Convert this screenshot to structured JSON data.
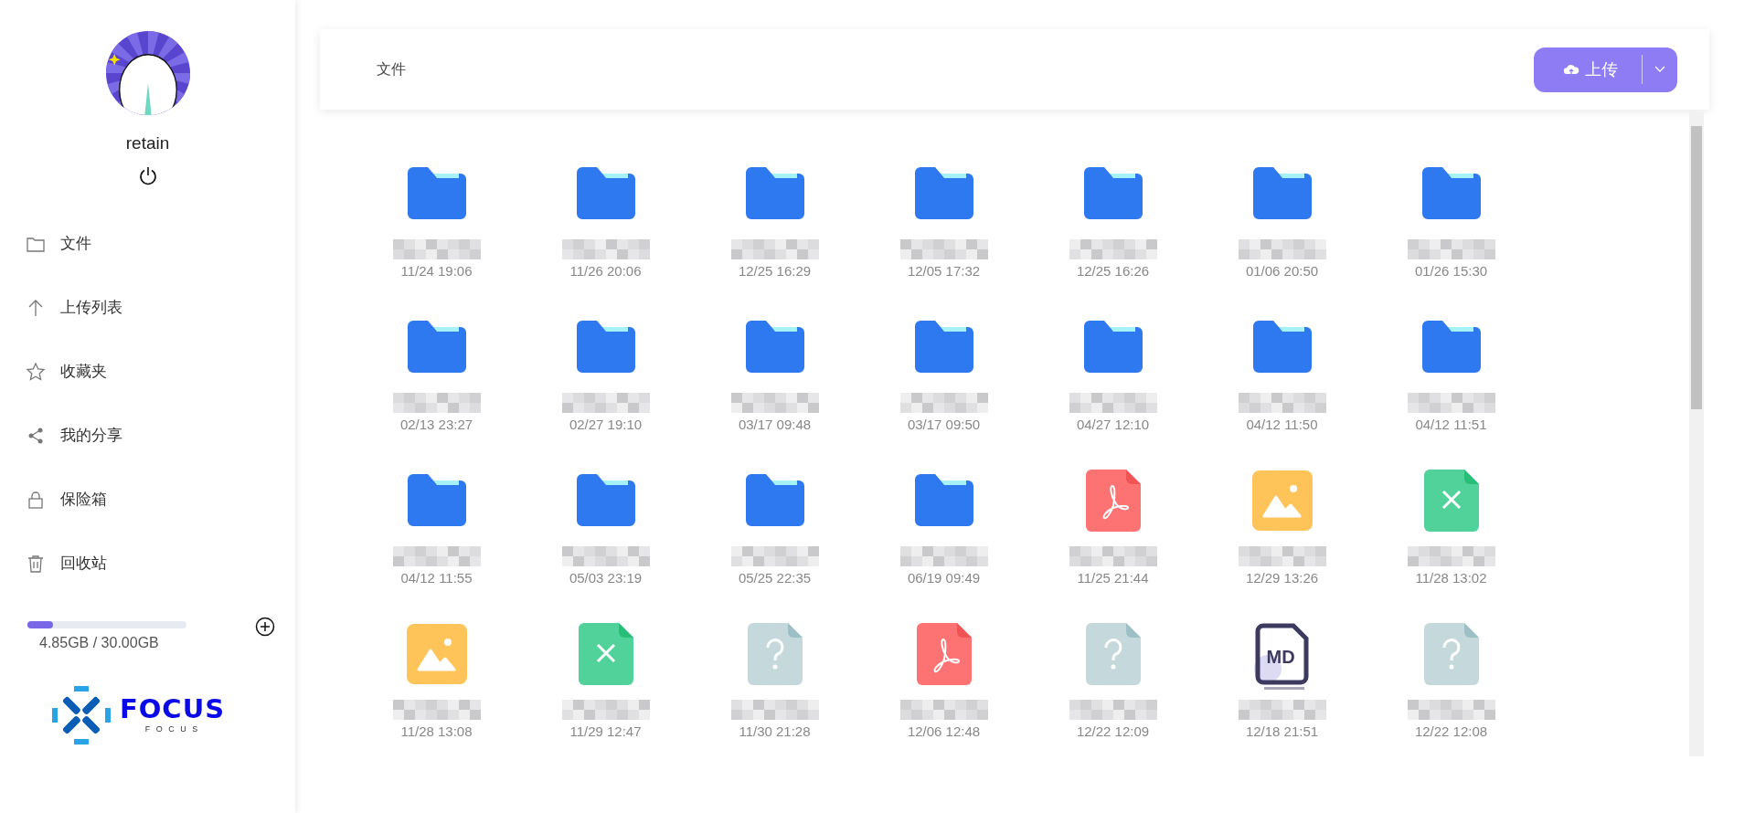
{
  "user": {
    "name": "retain"
  },
  "nav": [
    {
      "label": "文件"
    },
    {
      "label": "上传列表"
    },
    {
      "label": "收藏夹"
    },
    {
      "label": "我的分享"
    },
    {
      "label": "保险箱"
    },
    {
      "label": "回收站"
    }
  ],
  "storage": {
    "level": 0.16,
    "reading": "4.85GB / 30.00GB"
  },
  "logo": {
    "text": "FOCUS",
    "subtitle": "F O C U S"
  },
  "header": {
    "title": "文件",
    "upload_button": "上传"
  },
  "files": [
    {
      "kind": "folder",
      "time": "11/24 19:06"
    },
    {
      "kind": "folder",
      "time": "11/26 20:06"
    },
    {
      "kind": "folder",
      "time": "12/25 16:29"
    },
    {
      "kind": "folder",
      "time": "12/05 17:32"
    },
    {
      "kind": "folder",
      "time": "12/25 16:26"
    },
    {
      "kind": "folder",
      "time": "01/06 20:50"
    },
    {
      "kind": "folder",
      "time": "01/26 15:30"
    },
    {
      "kind": "folder",
      "time": "02/13 23:27"
    },
    {
      "kind": "folder",
      "time": "02/27 19:10"
    },
    {
      "kind": "folder",
      "time": "03/17 09:48"
    },
    {
      "kind": "folder",
      "time": "03/17 09:50"
    },
    {
      "kind": "folder",
      "time": "04/27 12:10"
    },
    {
      "kind": "folder",
      "time": "04/12 11:50"
    },
    {
      "kind": "folder",
      "time": "04/12 11:51"
    },
    {
      "kind": "folder",
      "time": "04/12 11:55"
    },
    {
      "kind": "folder",
      "time": "05/03 23:19"
    },
    {
      "kind": "folder",
      "time": "05/25 22:35"
    },
    {
      "kind": "folder",
      "time": "06/19 09:49"
    },
    {
      "kind": "pdf",
      "time": "11/25 21:44"
    },
    {
      "kind": "image",
      "time": "12/29 13:26"
    },
    {
      "kind": "excel",
      "time": "11/28 13:02"
    },
    {
      "kind": "image",
      "time": "11/28 13:08"
    },
    {
      "kind": "excel",
      "time": "11/29 12:47"
    },
    {
      "kind": "unknown",
      "time": "11/30 21:28"
    },
    {
      "kind": "pdf",
      "time": "12/06 12:48"
    },
    {
      "kind": "unknown",
      "time": "12/22 12:09"
    },
    {
      "kind": "markdown",
      "time": "12/18 21:51",
      "badge": "MD"
    },
    {
      "kind": "unknown",
      "time": "12/22 12:08"
    }
  ]
}
